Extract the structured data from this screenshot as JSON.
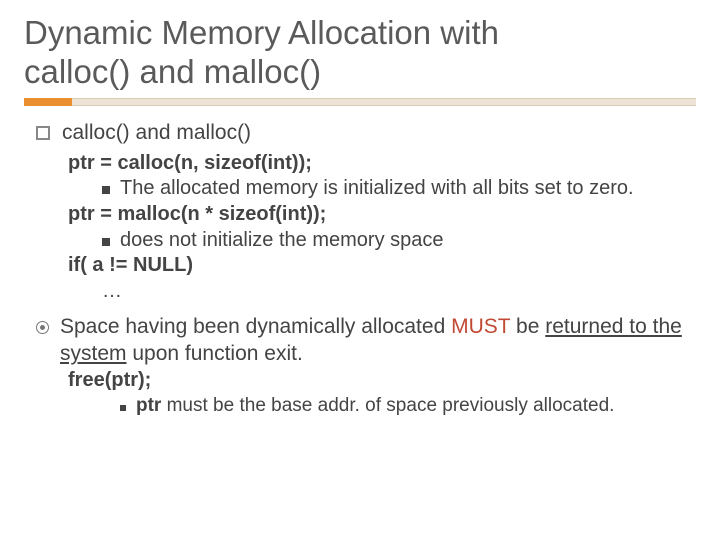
{
  "title_line1": "Dynamic Memory Allocation with",
  "title_line2": "calloc() and malloc()",
  "h1": "calloc() and malloc()",
  "code1": "ptr = calloc(n, sizeof(int));",
  "note1": "The allocated memory is initialized with all bits set to zero.",
  "code2": "ptr = malloc(n * sizeof(int));",
  "note2": "does not initialize the memory space",
  "code3": "if( a != NULL)",
  "code3b": "…",
  "p2a": "Space having been dynamically allocated ",
  "p2_must": "MUST",
  "p2b": " be ",
  "p2c": "returned to the system",
  "p2d": " upon function exit.",
  "code4": "free(ptr);",
  "note3a": "ptr",
  "note3b": " must be the base addr. of space previously allocated."
}
